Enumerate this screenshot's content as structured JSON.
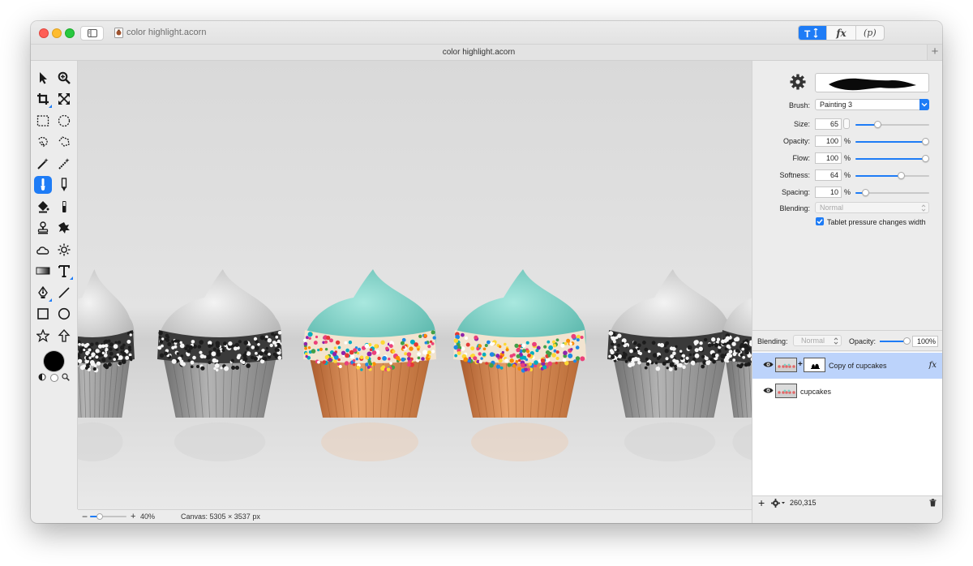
{
  "window": {
    "title": "color highlight.acorn",
    "document_tab_title": "color highlight.acorn",
    "toolbar_segments": [
      {
        "icon": "text-size-icon",
        "label": "T↕",
        "active": true
      },
      {
        "icon": "fx-icon",
        "label": "fx",
        "active": false
      },
      {
        "icon": "p-icon",
        "label": "(p)",
        "active": false
      }
    ]
  },
  "tools": [
    {
      "name": "move-tool"
    },
    {
      "name": "zoom-tool"
    },
    {
      "name": "crop-tool"
    },
    {
      "name": "transform-tool"
    },
    {
      "name": "rect-select-tool"
    },
    {
      "name": "ellipse-select-tool"
    },
    {
      "name": "lasso-tool"
    },
    {
      "name": "polygon-lasso-tool"
    },
    {
      "name": "magic-wand-tool"
    },
    {
      "name": "instant-alpha-tool"
    },
    {
      "name": "brush-tool",
      "active": true
    },
    {
      "name": "pencil-tool"
    },
    {
      "name": "paint-bucket-tool"
    },
    {
      "name": "eraser-tool"
    },
    {
      "name": "clone-stamp-tool"
    },
    {
      "name": "smudge-tool"
    },
    {
      "name": "cloud-tool"
    },
    {
      "name": "burn-dodge-tool"
    },
    {
      "name": "gradient-tool"
    },
    {
      "name": "text-tool"
    },
    {
      "name": "bezier-pen-tool"
    },
    {
      "name": "line-tool"
    },
    {
      "name": "rect-shape-tool"
    },
    {
      "name": "oval-shape-tool"
    },
    {
      "name": "star-tool"
    },
    {
      "name": "arrow-tool"
    }
  ],
  "colors": {
    "accent": "#1e7cf6",
    "foreground": "#000000",
    "background": "#ffffff",
    "frosting": "#7ed3c9",
    "cake": "#d98b52"
  },
  "canvas": {
    "zoom": "40%",
    "info": "Canvas: 5305 × 3537 px"
  },
  "brush_panel": {
    "brush_label": "Brush:",
    "brush_value": "Painting 3",
    "settings": [
      {
        "label": "Size:",
        "value": "65",
        "unit": "",
        "fraction": 0.28
      },
      {
        "label": "Opacity:",
        "value": "100",
        "unit": "%",
        "fraction": 1.0
      },
      {
        "label": "Flow:",
        "value": "100",
        "unit": "%",
        "fraction": 1.0
      },
      {
        "label": "Softness:",
        "value": "64",
        "unit": "%",
        "fraction": 0.64
      },
      {
        "label": "Spacing:",
        "value": "10",
        "unit": "%",
        "fraction": 0.1
      }
    ],
    "blending_label": "Blending:",
    "blending_value": "Normal",
    "tablet_pressure_label": "Tablet pressure changes width",
    "tablet_pressure_checked": true
  },
  "layers": {
    "blending_label": "Blending:",
    "blending_value": "Normal",
    "opacity_label": "Opacity:",
    "opacity_value": "100%",
    "items": [
      {
        "name": "Copy of cupcakes",
        "selected": true,
        "has_mask": true,
        "fx": "fx"
      },
      {
        "name": "cupcakes",
        "selected": false,
        "has_mask": false,
        "fx": ""
      }
    ],
    "coords": "260,315"
  }
}
